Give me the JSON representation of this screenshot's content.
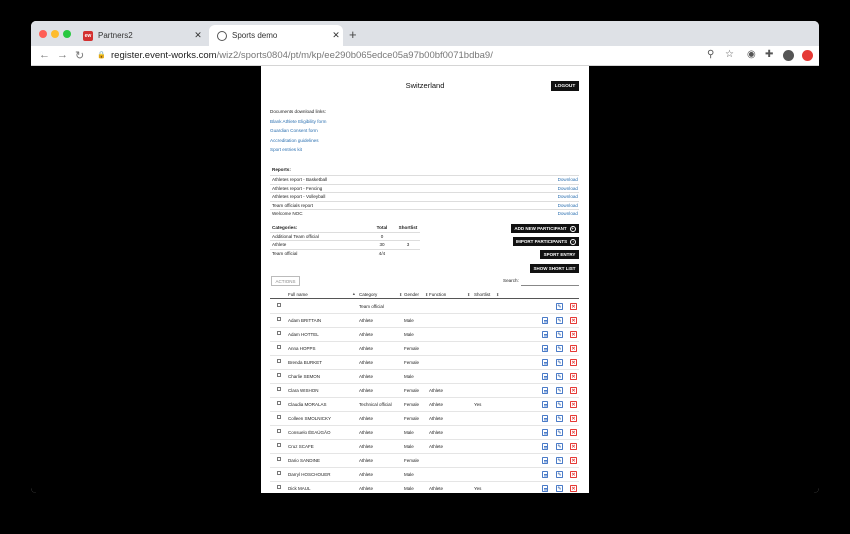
{
  "browser": {
    "tabs": [
      {
        "title": "Partners2",
        "favicon": "ew-logo-icon"
      },
      {
        "title": "Sports demo",
        "favicon": "globe-icon"
      }
    ],
    "url_host": "register.event-works.com",
    "url_path": "/wiz2/sports0804/pt/m/kp/ee290b065edce05a97b00bf0071bdba9/"
  },
  "header": {
    "country": "Switzerland",
    "logout": "LOGOUT"
  },
  "documents": {
    "title": "Documents download links:",
    "links": [
      "Blank Athlete Eligibility form",
      "Guardian Consent form",
      "Accreditation guidelines",
      "Sport entries kit"
    ]
  },
  "reports": {
    "title": "Reports:",
    "download_label": "Download",
    "items": [
      "Athletes report - Basketball",
      "Athletes report - Fencing",
      "Athletes report - Volleyball",
      "Team officials report",
      "Welcome NOC"
    ]
  },
  "categories": {
    "headers": [
      "Categories:",
      "Total",
      "Shortlist"
    ],
    "rows": [
      [
        "Additional Team official",
        "0",
        ""
      ],
      [
        "Athlete",
        "30",
        "3"
      ],
      [
        "Team official",
        "4/4",
        ""
      ]
    ]
  },
  "buttons": {
    "add_participant": "ADD NEW PARTICIPANT",
    "import_participants": "IMPORT PARTICIPANTS",
    "sport_entry": "SPORT ENTRY",
    "show_short_list": "SHOW SHORT LIST",
    "actions": "ACTIONS"
  },
  "search": {
    "label": "Search:",
    "value": ""
  },
  "table": {
    "columns": [
      "Full name",
      "Category",
      "Gender",
      "Function",
      "Shortlist"
    ],
    "rows": [
      [
        "",
        "Team official",
        "",
        "",
        ""
      ],
      [
        "Adam BRITTAIN",
        "Athlete",
        "Male",
        "",
        ""
      ],
      [
        "Adam HOTTEL",
        "Athlete",
        "Male",
        "",
        ""
      ],
      [
        "Anna HOPPS",
        "Athlete",
        "Female",
        "",
        ""
      ],
      [
        "Brenda BURKET",
        "Athlete",
        "Female",
        "",
        ""
      ],
      [
        "Charlie SEMON",
        "Athlete",
        "Male",
        "",
        ""
      ],
      [
        "Clara WISHON",
        "Athlete",
        "Female",
        "Athlete",
        ""
      ],
      [
        "Claudia MORALAS",
        "Technical official",
        "Female",
        "Athlete",
        "Yes"
      ],
      [
        "Colleen SMOLNICKY",
        "Athlete",
        "Female",
        "Athlete",
        ""
      ],
      [
        "Consuelo ÉEAÚGÃO",
        "Athlete",
        "Male",
        "Athlete",
        ""
      ],
      [
        "Cruz SCAFE",
        "Athlete",
        "Male",
        "Athlete",
        ""
      ],
      [
        "Dario SANDINE",
        "Athlete",
        "Female",
        "",
        ""
      ],
      [
        "Darryl HOSCHOUER",
        "Athlete",
        "Male",
        "",
        ""
      ],
      [
        "Dick MAUL",
        "Athlete",
        "Male",
        "Athlete",
        "Yes"
      ]
    ]
  }
}
